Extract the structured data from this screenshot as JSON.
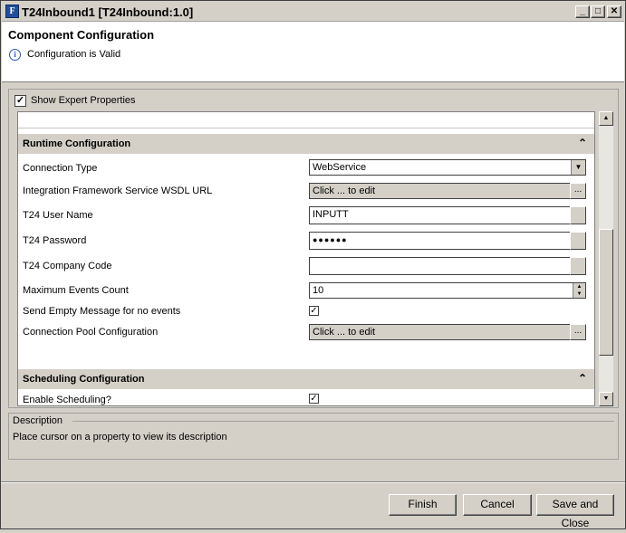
{
  "window": {
    "app_icon_letter": "F",
    "title": "T24Inbound1 [T24Inbound:1.0]",
    "minimize": "_",
    "maximize": "□",
    "close": "✕"
  },
  "header": {
    "title": "Component Configuration",
    "status_icon": "info-icon",
    "status": "Configuration is Valid"
  },
  "expert": {
    "label": "Show Expert Properties",
    "checked": true
  },
  "runtime": {
    "title": "Runtime Configuration",
    "props": [
      {
        "label": "Connection Type",
        "value": "WebService",
        "kind": "dropdown"
      },
      {
        "label": "Integration Framework Service WSDL URL",
        "value": "Click ... to edit",
        "kind": "edit"
      },
      {
        "label": "T24 User Name",
        "value": "INPUTT",
        "kind": "text"
      },
      {
        "label": "T24 Password",
        "value": "●●●●●●",
        "kind": "password"
      },
      {
        "label": "T24 Company Code",
        "value": "",
        "kind": "text"
      },
      {
        "label": "Maximum Events Count",
        "value": "10",
        "kind": "spinner"
      },
      {
        "label": "Send Empty Message for no events",
        "value": "✓",
        "kind": "checkbox"
      },
      {
        "label": "Connection Pool Configuration",
        "value": "Click ... to edit",
        "kind": "edit"
      }
    ]
  },
  "scheduling": {
    "title": "Scheduling Configuration",
    "props": [
      {
        "label": "Enable Scheduling?",
        "value": "✓",
        "kind": "checkbox"
      }
    ]
  },
  "description": {
    "title": "Description",
    "text": "Place cursor on a property to view its description"
  },
  "buttons": {
    "finish": "Finish",
    "cancel": "Cancel",
    "save_close": "Save and Close"
  }
}
